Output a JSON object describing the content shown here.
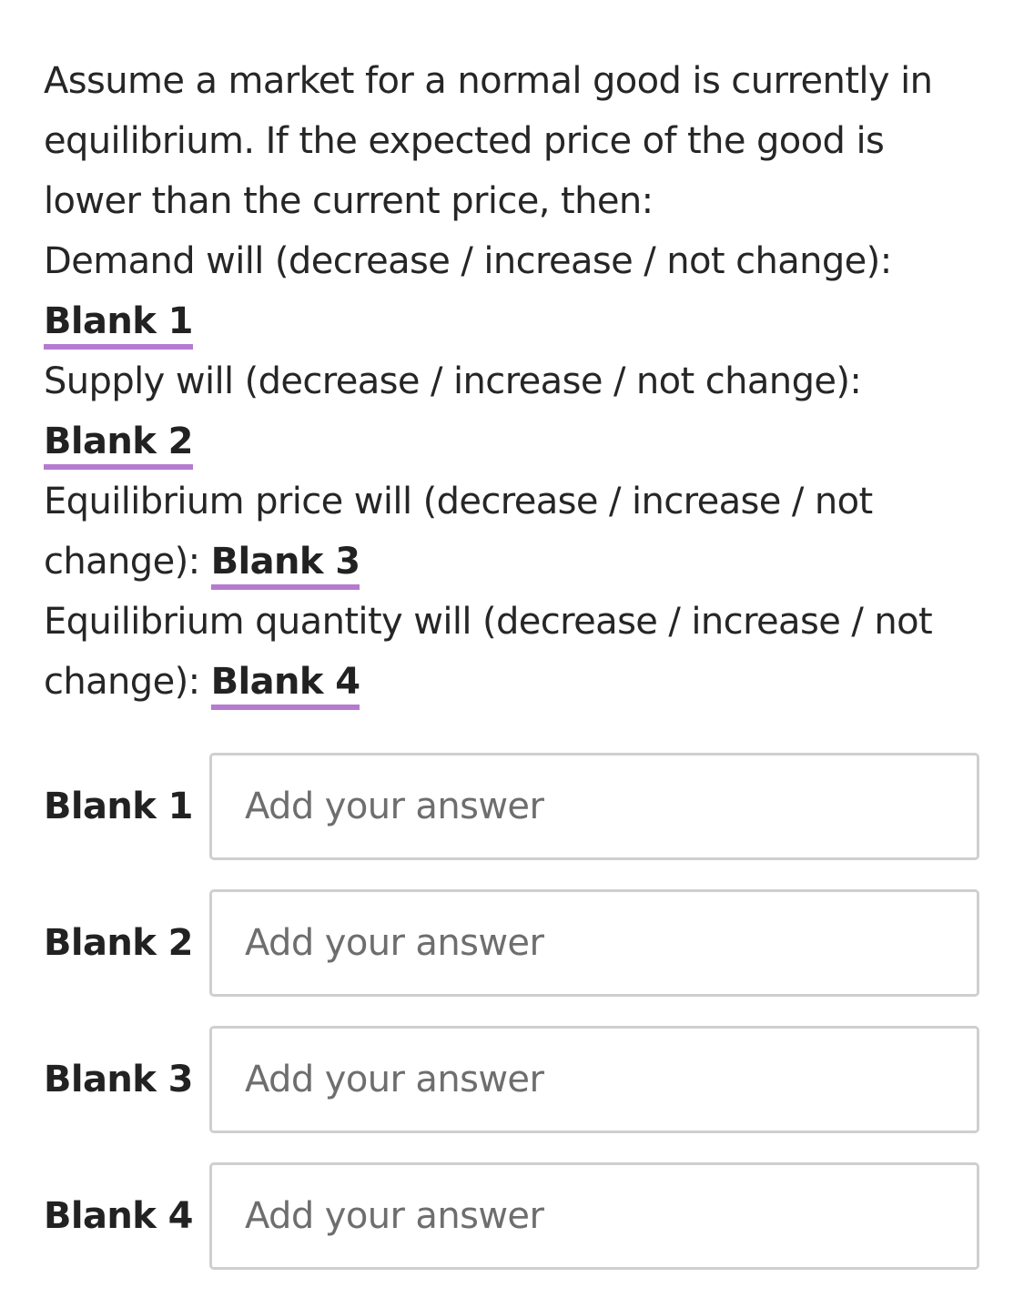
{
  "question": {
    "intro": "Assume a market for a normal good is currently in equilibrium. If the expected price of the good is lower than the current price, then:",
    "items": [
      {
        "prompt": "Demand will (decrease / increase / not change): ",
        "blank": "Blank 1"
      },
      {
        "prompt": "Supply will (decrease / increase / not change): ",
        "blank": "Blank 2"
      },
      {
        "prompt": "Equilibrium price will (decrease / increase / not change): ",
        "blank": "Blank 3"
      },
      {
        "prompt": "Equilibrium quantity will (decrease / increase / not change): ",
        "blank": "Blank 4"
      }
    ]
  },
  "answers": [
    {
      "label": "Blank 1",
      "value": "",
      "placeholder": "Add your answer"
    },
    {
      "label": "Blank 2",
      "value": "",
      "placeholder": "Add your answer"
    },
    {
      "label": "Blank 3",
      "value": "",
      "placeholder": "Add your answer"
    },
    {
      "label": "Blank 4",
      "value": "",
      "placeholder": "Add your answer"
    }
  ],
  "colors": {
    "blank_underline": "#b57bd0",
    "text": "#262626",
    "input_border": "#cfcfcf"
  }
}
